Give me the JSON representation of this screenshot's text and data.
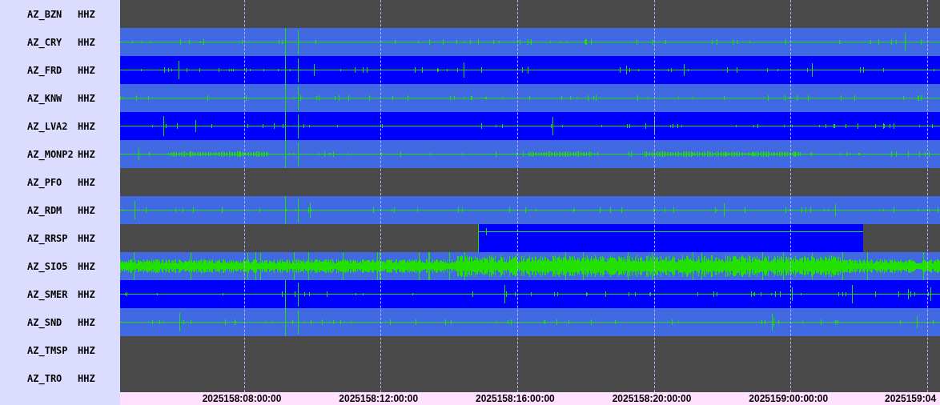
{
  "rows": [
    {
      "station": "AZ_BZN",
      "channel": "HHZ",
      "kind": "none"
    },
    {
      "station": "AZ_CRY",
      "channel": "HHZ",
      "kind": "quiet",
      "color": "#4169e1"
    },
    {
      "station": "AZ_FRD",
      "channel": "HHZ",
      "kind": "quiet",
      "color": "#0000ff"
    },
    {
      "station": "AZ_KNW",
      "channel": "HHZ",
      "kind": "quiet",
      "color": "#4169e1"
    },
    {
      "station": "AZ_LVA2",
      "channel": "HHZ",
      "kind": "quiet",
      "color": "#0000ff"
    },
    {
      "station": "AZ_MONP2",
      "channel": "HHZ",
      "kind": "bursty",
      "color": "#4169e1"
    },
    {
      "station": "AZ_PFO",
      "channel": "HHZ",
      "kind": "none"
    },
    {
      "station": "AZ_RDM",
      "channel": "HHZ",
      "kind": "quiet",
      "color": "#4169e1"
    },
    {
      "station": "AZ_RRSP",
      "channel": "HHZ",
      "kind": "partial",
      "color": "#0000ff"
    },
    {
      "station": "AZ_SIO5",
      "channel": "HHZ",
      "kind": "noisy",
      "color": "#4169e1"
    },
    {
      "station": "AZ_SMER",
      "channel": "HHZ",
      "kind": "quiet",
      "color": "#0000ff"
    },
    {
      "station": "AZ_SND",
      "channel": "HHZ",
      "kind": "quiet",
      "color": "#4169e1"
    },
    {
      "station": "AZ_TMSP",
      "channel": "HHZ",
      "kind": "none"
    },
    {
      "station": "AZ_TRO",
      "channel": "HHZ",
      "kind": "none"
    }
  ],
  "time_axis": [
    "2025158:08:00:00",
    "2025158:12:00:00",
    "2025158:16:00:00",
    "2025158:20:00:00",
    "2025159:00:00:00",
    "2025159:04"
  ]
}
